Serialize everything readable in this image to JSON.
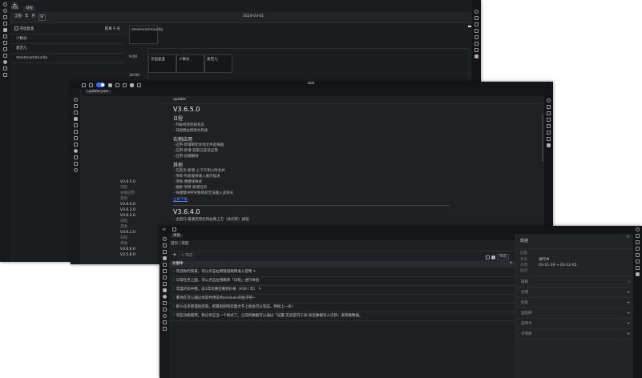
{
  "w1": {
    "tabs": [
      "项目",
      "日程"
    ],
    "views": [
      "全部",
      "年",
      "月",
      "日"
    ],
    "date": "2024-03-01",
    "list": [
      {
        "title": "牙齿复查",
        "right": "距离 9 天"
      },
      {
        "title": "少数派"
      },
      {
        "title": "爱范儿"
      },
      {
        "title": "steamcommunity"
      }
    ],
    "allday": "steamcommunity",
    "times": [
      "9:00",
      "10:00"
    ],
    "events": [
      "牙齿复查",
      "少数派",
      "爱范儿"
    ]
  },
  "w2": {
    "tab": "update.json",
    "heading": "update",
    "v1": "V3.6.5.0",
    "s1": "日程",
    "s1_items": [
      "列表修改完成状态",
      "日视图左侧改为列表"
    ],
    "s2": "右侧应用",
    "s2_items": [
      "应用-新增绑定本地文件选择器",
      "应用-新增-获取已安装应用",
      "应用-右键删除"
    ],
    "s3": "其他",
    "s3_items": [
      "信息流-新增-上下午和小时合并",
      "项目-列表能够收入展示描述",
      "项目-便捷线样式",
      "搜索-项目-新增任务",
      "快捷键冲突导致目前无法输入波浪号"
    ],
    "link": "立即下载",
    "v2": "V3.6.4.0",
    "v2_items": [
      "主窗口-最满足侧栏和右侧上方（关闭等）按钮"
    ],
    "toc": [
      "V3.6.5.0",
      "日程",
      "右侧应用",
      "其他",
      "V3.6.4.0",
      "V3.6.3.0",
      "V3.6.2.0",
      "日程",
      "其他",
      "V3.6.1.0",
      "日程",
      "其他",
      "V3.6.0.0",
      "V3.5.8.0"
    ]
  },
  "w3": {
    "tab": "项目",
    "breadcrumb": "首页 / 欢迎",
    "filter": "筛选",
    "right_btn": "筛选",
    "group": "计划中",
    "tasks": [
      "欢迎你的到来，可以点击右侧链接跳转进入官网",
      "日常任务上面，可以点击左侧跳转「日程」进行体验",
      "年度折扣中哦，前1年优惠还剩到价格（¥30 / 年）",
      "看你在可以通过本软件预览Markdown的帖子吧~",
      "那么任务管理就结束，把最后刷到后面文字上就会可以完成，例如上一条！",
      "有些功能都用，和分享应当一个样式了。之前的数据可以通过「设置-实验室内工具-知名数据导入迁移」来转换数据。"
    ],
    "panel": {
      "title": "欢迎",
      "info": "信息",
      "status_label": "状态",
      "status": "进行中",
      "date_label": "日期",
      "date": "03-11-29 → 03-12-05",
      "desc": "描述",
      "sections": [
        "链接",
        "文档",
        "标签",
        "里程碑",
        "选项卡",
        "子项目"
      ]
    }
  }
}
